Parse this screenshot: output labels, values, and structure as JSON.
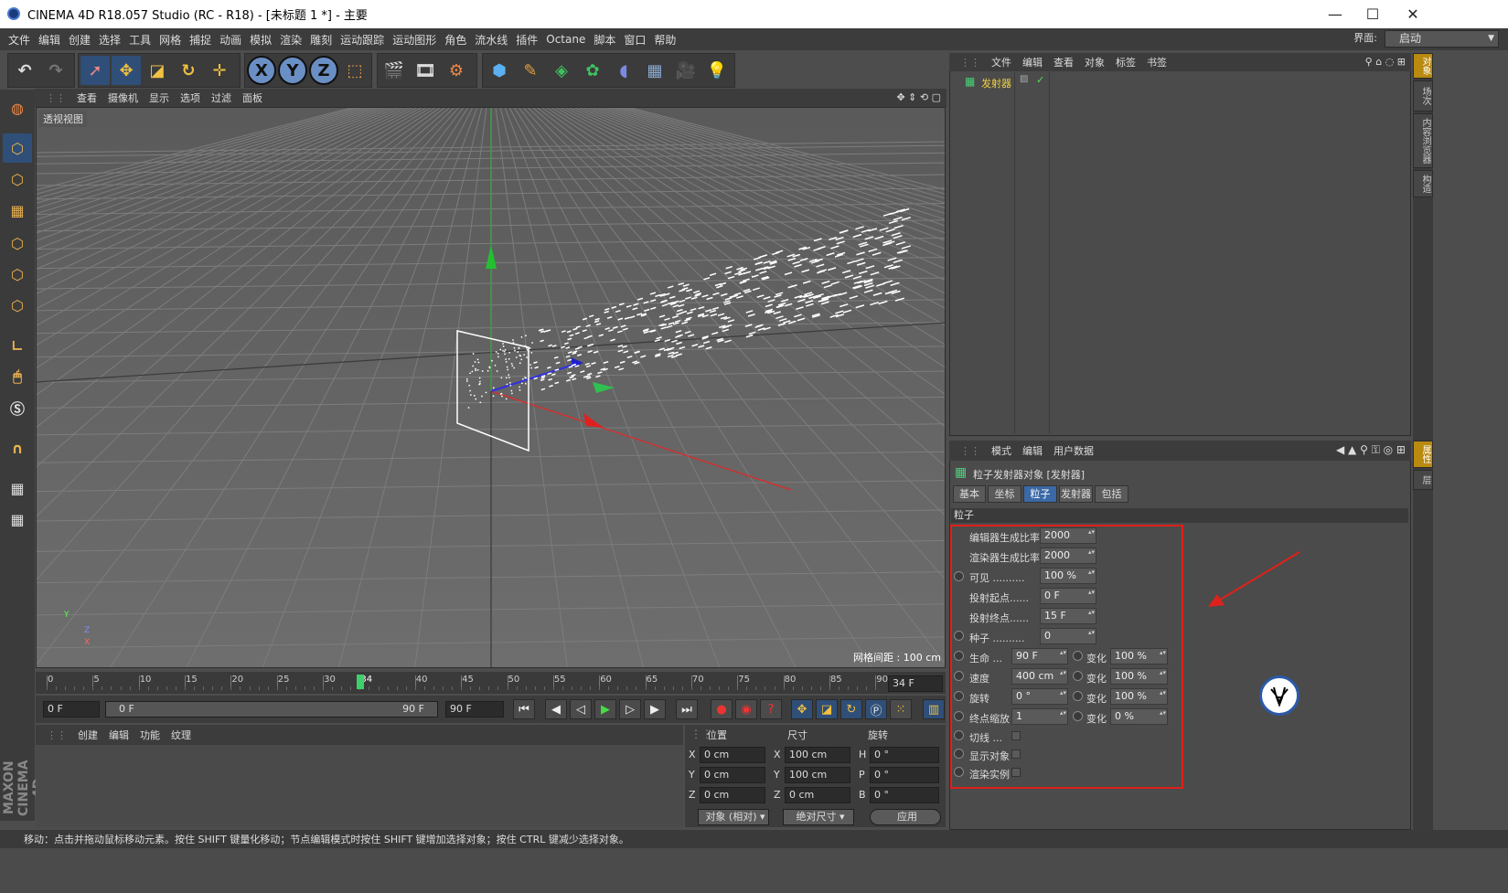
{
  "window": {
    "title": "CINEMA 4D R18.057 Studio (RC - R18) - [未标题 1 *] - 主要",
    "minimize": "—",
    "maximize": "☐",
    "close": "✕"
  },
  "menu": [
    "文件",
    "编辑",
    "创建",
    "选择",
    "工具",
    "网格",
    "捕捉",
    "动画",
    "模拟",
    "渲染",
    "雕刻",
    "运动跟踪",
    "运动图形",
    "角色",
    "流水线",
    "插件",
    "Octane",
    "脚本",
    "窗口",
    "帮助"
  ],
  "layout": {
    "label": "界面:",
    "value": "启动"
  },
  "toolbar": {
    "axis_x": "X",
    "axis_y": "Y",
    "axis_z": "Z"
  },
  "viewport": {
    "menu": [
      "查看",
      "摄像机",
      "显示",
      "选项",
      "过滤",
      "面板"
    ],
    "label": "透视视图",
    "grid_spacing": "网格间距 : 100 cm",
    "axis_y": "Y",
    "axis_z": "Z",
    "axis_x": "X"
  },
  "timeline": {
    "ticks": [
      "0",
      "5",
      "10",
      "15",
      "20",
      "25",
      "30",
      "34",
      "40",
      "45",
      "50",
      "55",
      "60",
      "65",
      "70",
      "75",
      "80",
      "85",
      "90"
    ],
    "current": "34",
    "end_field": "34 F"
  },
  "playbar": {
    "start": "0 F",
    "range_start": "0 F",
    "range_end": "90 F",
    "end": "90 F"
  },
  "material": {
    "menu": [
      "创建",
      "编辑",
      "功能",
      "纹理"
    ]
  },
  "coords": {
    "headers": [
      "位置",
      "尺寸",
      "旋转"
    ],
    "rows": [
      {
        "a": "X",
        "pos": "0 cm",
        "b": "X",
        "size": "100 cm",
        "c": "H",
        "rot": "0 °"
      },
      {
        "a": "Y",
        "pos": "0 cm",
        "b": "Y",
        "size": "100 cm",
        "c": "P",
        "rot": "0 °"
      },
      {
        "a": "Z",
        "pos": "0 cm",
        "b": "Z",
        "size": "0 cm",
        "c": "B",
        "rot": "0 °"
      }
    ],
    "mode": "对象 (相对)",
    "size_mode": "绝对尺寸",
    "apply": "应用"
  },
  "status": "移动：点击并拖动鼠标移动元素。按住 SHIFT 键量化移动；节点编辑模式时按住 SHIFT 键增加选择对象；按住 CTRL 键减少选择对象。",
  "objects": {
    "menu": [
      "文件",
      "编辑",
      "查看",
      "对象",
      "标签",
      "书签"
    ],
    "item": "发射器"
  },
  "attributes": {
    "menu": [
      "模式",
      "编辑",
      "用户数据"
    ],
    "title": "粒子发射器对象 [发射器]",
    "tabs": [
      "基本",
      "坐标",
      "粒子",
      "发射器",
      "包括"
    ],
    "section": "粒子",
    "params": {
      "editor_rate_label": "编辑器生成比率",
      "editor_rate": "2000",
      "render_rate_label": "渲染器生成比率",
      "render_rate": "2000",
      "visible_label": "可见 ..........",
      "visible": "100 %",
      "start_label": "投射起点......",
      "start": "0 F",
      "stop_label": "投射终点......",
      "stop": "15 F",
      "seed_label": "种子 ..........",
      "seed": "0",
      "life_label": "生命 ...",
      "life": "90 F",
      "life_var": "100 %",
      "speed_label": "速度",
      "speed": "400 cm",
      "speed_var": "100 %",
      "rot_label": "旋转",
      "rot": "0 °",
      "rot_var": "100 %",
      "scale_label": "终点缩放",
      "scale": "1",
      "scale_var": "0 %",
      "var_label": "变化",
      "tangential_label": "切线 ...",
      "show_label": "显示对象",
      "render_label": "渲染实例"
    }
  },
  "side_tabs": [
    "对象",
    "场次",
    "内容浏览器",
    "构造",
    "属性",
    "层"
  ],
  "brand": "MAXON CINEMA 4D",
  "colors": {
    "accent": "#3a69a5",
    "annotation": "#e0201a"
  }
}
